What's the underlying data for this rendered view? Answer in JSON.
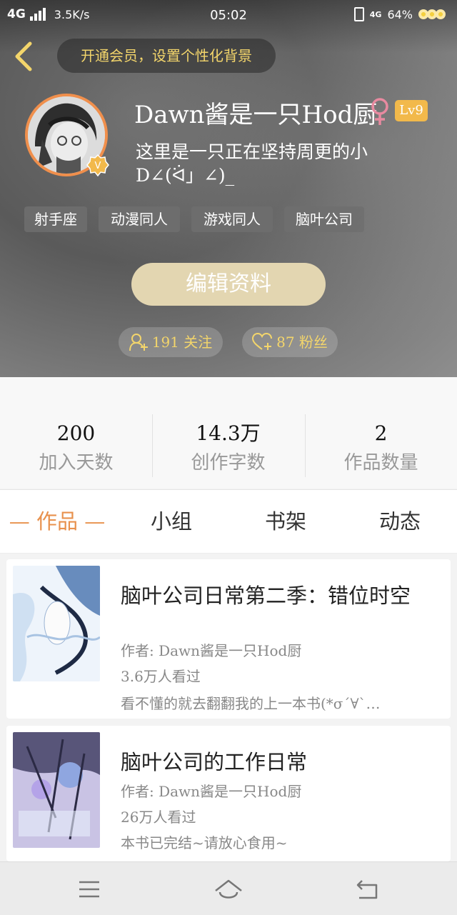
{
  "status_bar": {
    "network": "4G",
    "speed": "3.5K/s",
    "time": "05:02",
    "network_right": "4G",
    "battery": "64%"
  },
  "header": {
    "vip_prompt": "开通会员，设置个性化背景",
    "nickname": "Dawn酱是一只Hod厨",
    "gender_icon": "female-icon",
    "level": "Lv9",
    "vip_badge_letter": "V",
    "bio_line1": "这里是一只正在坚持周更的小",
    "bio_line2": "D∠(ᐛ」∠)_",
    "tags": [
      "射手座",
      "动漫同人",
      "游戏同人",
      "脑叶公司"
    ],
    "edit_label": "编辑资料",
    "following": "191 关注",
    "followers": "87 粉丝"
  },
  "stats": [
    {
      "value": "200",
      "label": "加入天数"
    },
    {
      "value": "14.3万",
      "label": "创作字数"
    },
    {
      "value": "2",
      "label": "作品数量"
    }
  ],
  "tabs": [
    "— 作品 —",
    "小组",
    "书架",
    "动态"
  ],
  "books": [
    {
      "title": "脑叶公司日常第二季：错位时空",
      "author": "作者: Dawn酱是一只Hod厨",
      "views": "3.6万人看过",
      "desc": "看不懂的就去翻翻我的上一本书(*σ´∀`…"
    },
    {
      "title": "脑叶公司的工作日常",
      "author": "作者: Dawn酱是一只Hod厨",
      "views": "26万人看过",
      "desc": "本书已完结~请放心食用~"
    }
  ],
  "colors": {
    "accent": "#e8914d",
    "gold": "#f3d56b",
    "level": "#f2b94b",
    "edit_button": "#e3d6b1",
    "gender": "#e88aa0"
  }
}
